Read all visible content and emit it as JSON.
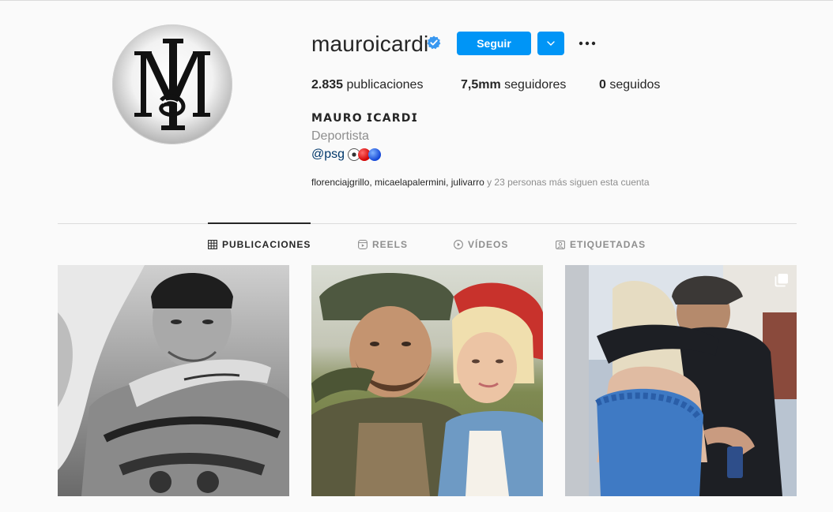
{
  "profile": {
    "username": "mauroicardi",
    "full_name": "𝗠𝗔𝗨𝗥𝗢 𝗜𝗖𝗔𝗥𝗗𝗜",
    "category": "Deportista",
    "bio_mention": "@psg",
    "bio_emoji": "⚽🔴🔵",
    "avatar_icon": "mi-monogram-logo",
    "avatar_monogram": "MI"
  },
  "actions": {
    "follow_label": "Seguir",
    "dropdown_icon": "chevron-down-icon",
    "more_icon": "more-horizontal-icon",
    "accent_color": "#0095f6"
  },
  "stats": {
    "posts_count": "2.835",
    "posts_label": "publicaciones",
    "followers_count": "7,5mm",
    "followers_label": "seguidores",
    "following_count": "0",
    "following_label": "seguidos"
  },
  "followed_by": {
    "names": "florenciajgrillo, micaelapalermini, julivarro",
    "rest": " y 23 personas más siguen esta cuenta"
  },
  "tabs": [
    {
      "label": "PUBLICACIONES",
      "icon": "grid-icon",
      "active": true
    },
    {
      "label": "REELS",
      "icon": "reels-icon",
      "active": false
    },
    {
      "label": "VÍDEOS",
      "icon": "play-circle-icon",
      "active": false
    },
    {
      "label": "ETIQUETADAS",
      "icon": "tagged-icon",
      "active": false
    }
  ],
  "posts": [
    {
      "kind": "photo"
    },
    {
      "kind": "photo"
    },
    {
      "kind": "carousel",
      "icon": "multiple-images-icon"
    }
  ]
}
